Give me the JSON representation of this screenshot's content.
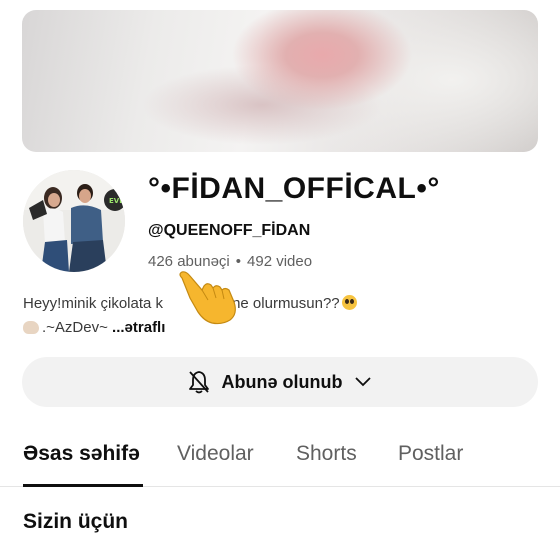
{
  "channel": {
    "name": "°•FİDAN_OFFİCAL•°",
    "handle": "@QUEENOFF_FİDAN",
    "subscribers": "426 abunəçi",
    "separator": "•",
    "videos": "492 video",
    "description_text": "Heyy!minik çikolata k",
    "description_text_2": "abone olurmusun??",
    "description_line2": ".~AzDev~",
    "more_label": "...ətraflı"
  },
  "subscribe_button": {
    "label": "Abunə olunub",
    "bell_icon": "bell-off-icon",
    "chevron_icon": "chevron-down-icon"
  },
  "tabs": [
    {
      "label": "Əsas səhifə",
      "active": true
    },
    {
      "label": "Videolar",
      "active": false
    },
    {
      "label": "Shorts",
      "active": false
    },
    {
      "label": "Postlar",
      "active": false
    }
  ],
  "section": {
    "title": "Sizin üçün"
  },
  "colors": {
    "text_primary": "#0f0f0f",
    "text_secondary": "#606060",
    "button_bg": "#f2f2f2"
  }
}
